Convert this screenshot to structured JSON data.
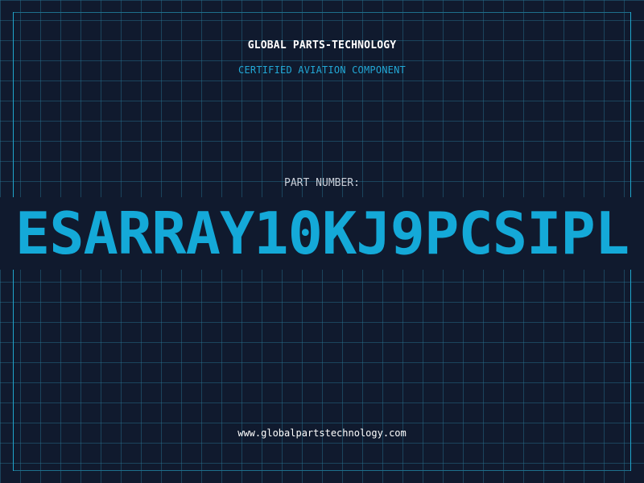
{
  "header": {
    "company": "GLOBAL PARTS-TECHNOLOGY",
    "subtitle": "CERTIFIED AVIATION COMPONENT"
  },
  "part": {
    "label": "PART NUMBER:",
    "number": "ESARRAY10KJ9PCSIPL"
  },
  "footer": {
    "website": "www.globalpartstechnology.com"
  },
  "colors": {
    "background": "#101a2e",
    "grid": "#287896",
    "accent": "#14a9d8",
    "text": "#ffffff"
  }
}
